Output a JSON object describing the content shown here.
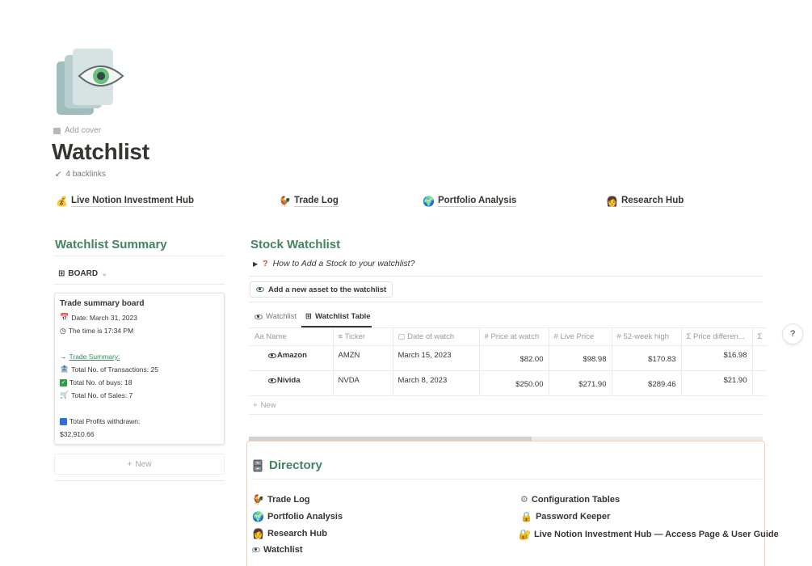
{
  "page": {
    "add_cover": "Add cover",
    "title": "Watchlist",
    "backlinks": "4 backlinks"
  },
  "top_links": [
    {
      "label": "Live Notion Investment Hub",
      "icon": "money-bag-icon"
    },
    {
      "label": "Trade Log",
      "icon": "rooster-icon"
    },
    {
      "label": "Portfolio Analysis",
      "icon": "globe-chart-icon"
    },
    {
      "label": "Research Hub",
      "icon": "researcher-icon"
    }
  ],
  "summary": {
    "heading": "Watchlist Summary",
    "view_label": "BOARD",
    "card": {
      "title": "Trade summary board",
      "date": "Date: March 31, 2023",
      "time": "The time is 17:34 PM",
      "arrow": "→",
      "trade_summary": "Trade Summary:",
      "transactions": "Total No. of Transactions: 25",
      "buys": "Total No. of buys: 18",
      "sales": "Total No. of Sales: 7",
      "profits_label": "Total Profits withdrawn:",
      "profits_value": "$32,910.66"
    },
    "new_label": "New"
  },
  "watchlist": {
    "heading": "Stock Watchlist",
    "toggle_text": "How to Add a Stock to your watchlist?",
    "add_button": "Add a new asset to the watchlist",
    "tabs": [
      {
        "label": "Watchlist",
        "active": false
      },
      {
        "label": "Watchlist Table",
        "active": true
      }
    ],
    "columns": [
      {
        "icon": "Aa",
        "label": "Name"
      },
      {
        "icon": "≡",
        "label": "Ticker"
      },
      {
        "icon": "▢",
        "label": "Date of watch"
      },
      {
        "icon": "#",
        "label": "Price at watch"
      },
      {
        "icon": "#",
        "label": "Live Price"
      },
      {
        "icon": "#",
        "label": "52-week high"
      },
      {
        "icon": "Σ",
        "label": "Price differen..."
      },
      {
        "icon": "Σ",
        "label": ""
      }
    ],
    "rows": [
      {
        "name": "Amazon",
        "ticker": "AMZN",
        "date": "March 15, 2023",
        "price_at_watch": "$82.00",
        "live_price": "$98.98",
        "high_52": "$170.83",
        "difference": "$16.98"
      },
      {
        "name": "Nivida",
        "ticker": "NVDA",
        "date": "March 8, 2023",
        "price_at_watch": "$250.00",
        "live_price": "$271.90",
        "high_52": "$289.46",
        "difference": "$21.90"
      }
    ],
    "new_label": "New"
  },
  "directory": {
    "heading": "Directory",
    "left": [
      {
        "label": "Trade Log",
        "icon": "rooster-icon"
      },
      {
        "label": "Portfolio Analysis",
        "icon": "globe-chart-icon"
      },
      {
        "label": "Research Hub",
        "icon": "researcher-icon"
      },
      {
        "label": "Watchlist",
        "icon": "eye-pages-icon"
      }
    ],
    "right": [
      {
        "label": "Configuration Tables",
        "icon": "gear-icon"
      },
      {
        "label": "Password Keeper",
        "icon": "lock-icon"
      },
      {
        "label": "Live Notion Investment Hub — Access Page & User Guide",
        "icon": "key-lock-icon"
      }
    ]
  },
  "help": "?",
  "colors": {
    "accent_green": "#448361",
    "text": "#37352f",
    "muted": "#9b9a97",
    "directory_border": "#f3c9b9"
  }
}
